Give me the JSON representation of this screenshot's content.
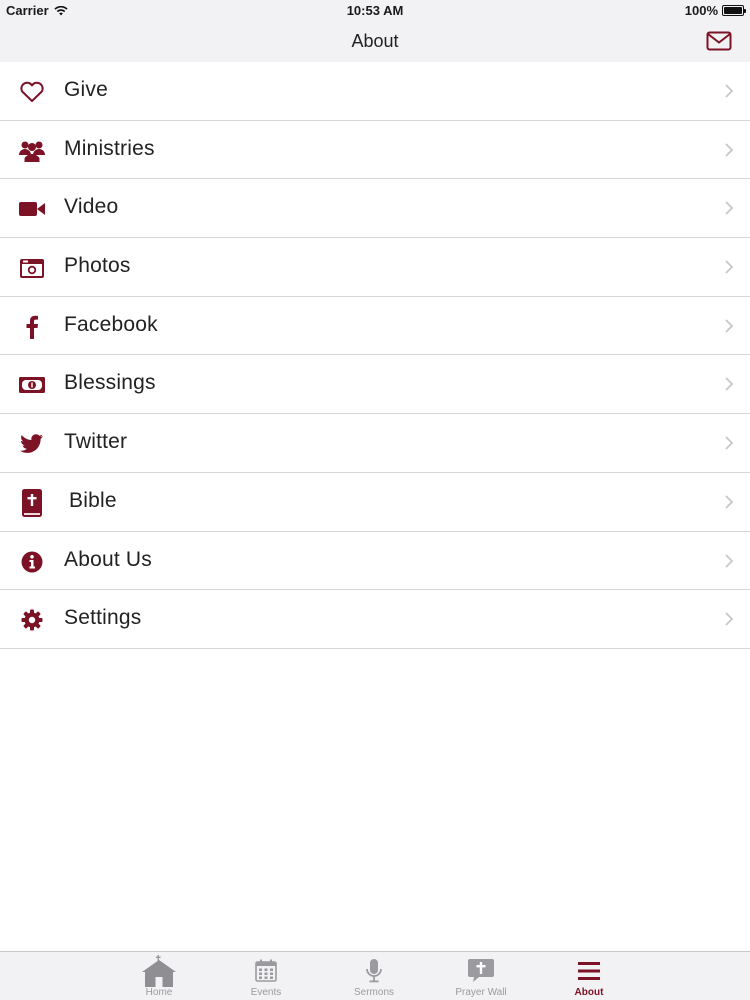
{
  "status_bar": {
    "carrier": "Carrier",
    "time": "10:53 AM",
    "battery": "100%"
  },
  "nav": {
    "title": "About",
    "mail_icon": "envelope-icon"
  },
  "menu": [
    {
      "label": "Give",
      "icon": "heart-icon"
    },
    {
      "label": "Ministries",
      "icon": "group-icon"
    },
    {
      "label": "Video",
      "icon": "video-camera-icon"
    },
    {
      "label": "Photos",
      "icon": "camera-icon"
    },
    {
      "label": "Facebook",
      "icon": "facebook-icon"
    },
    {
      "label": "Blessings",
      "icon": "money-icon"
    },
    {
      "label": "Twitter",
      "icon": "twitter-icon"
    },
    {
      "label": "Bible",
      "icon": "bible-icon"
    },
    {
      "label": "About Us",
      "icon": "info-icon"
    },
    {
      "label": "Settings",
      "icon": "gear-icon"
    }
  ],
  "tabs": [
    {
      "label": "Home",
      "icon": "church-icon"
    },
    {
      "label": "Events",
      "icon": "calendar-icon"
    },
    {
      "label": "Sermons",
      "icon": "microphone-icon"
    },
    {
      "label": "Prayer Wall",
      "icon": "prayer-bubble-icon"
    },
    {
      "label": "About",
      "icon": "hamburger-menu-icon",
      "active": true
    }
  ],
  "colors": {
    "accent": "#7c1226",
    "inactive_tab": "#9b9b9f",
    "bar_background": "#f2f2f4",
    "divider": "#d6d6d9"
  }
}
